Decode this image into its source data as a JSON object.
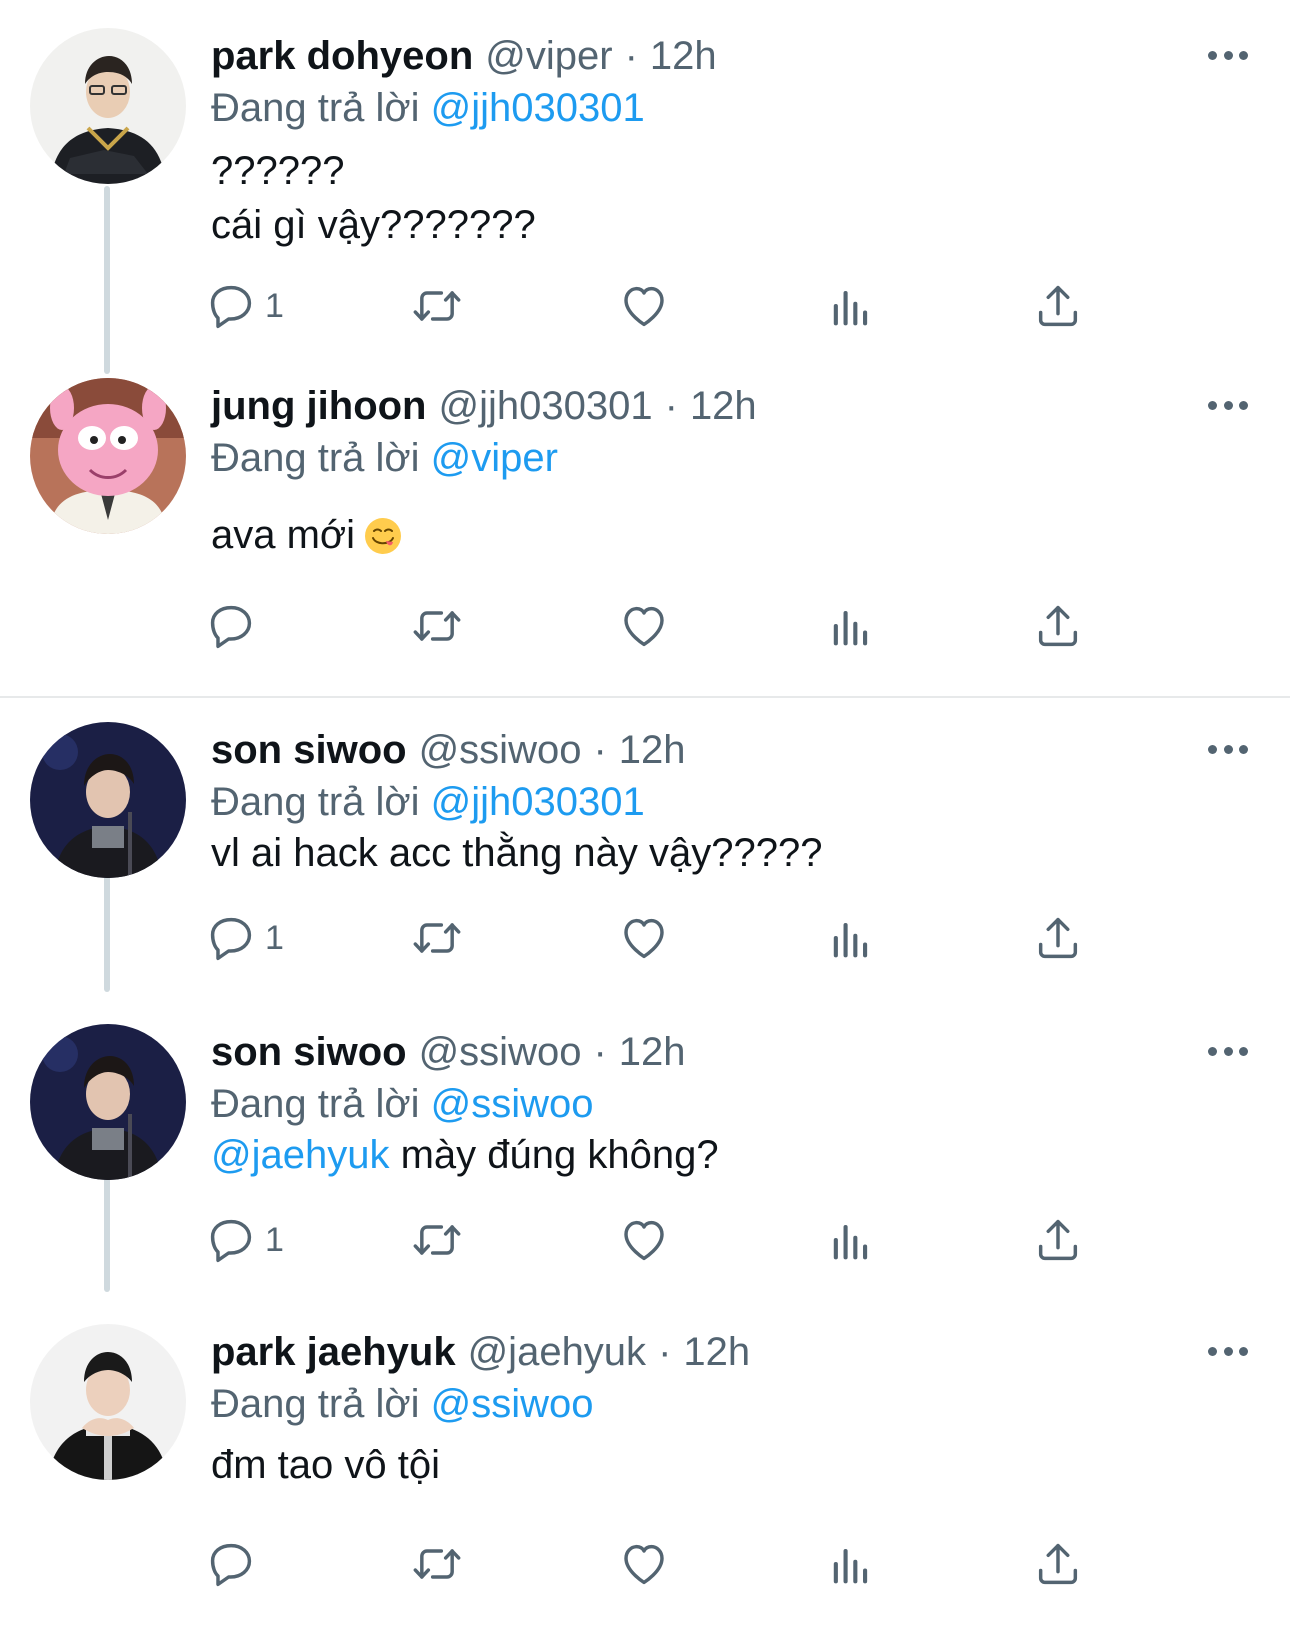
{
  "reply_prefix": "Đang trả lời",
  "tweets": [
    {
      "name": "park dohyeon",
      "handle": "@viper",
      "separator": "·",
      "time": "12h",
      "reply_to": "@jjh030301",
      "line1": "??????",
      "line2": "cái gì vậy???????",
      "reply_count": "1"
    },
    {
      "name": "jung jihoon",
      "handle": "@jjh030301",
      "separator": "·",
      "time": "12h",
      "reply_to": "@viper",
      "line1": "ava mới",
      "emoji": "smiling-face-savoring-food",
      "reply_count": ""
    },
    {
      "name": "son siwoo",
      "handle": "@ssiwoo",
      "separator": "·",
      "time": "12h",
      "reply_to": "@jjh030301",
      "line1": "vl ai hack acc thằng này vậy?????",
      "reply_count": "1"
    },
    {
      "name": "son siwoo",
      "handle": "@ssiwoo",
      "separator": "·",
      "time": "12h",
      "reply_to": "@ssiwoo",
      "line1_mention": "@jaehyuk",
      "line1": " mày đúng không?",
      "reply_count": "1"
    },
    {
      "name": "park jaehyuk",
      "handle": "@jaehyuk",
      "separator": "·",
      "time": "12h",
      "reply_to": "@ssiwoo",
      "line1": "đm tao vô tội",
      "reply_count": ""
    }
  ],
  "icons": {
    "reply": "reply-icon",
    "retweet": "retweet-icon",
    "like": "heart-icon",
    "views": "views-icon",
    "share": "share-icon",
    "more": "more-icon"
  },
  "colors": {
    "text": "#0f1419",
    "secondary": "#536471",
    "link": "#1d9bf0",
    "thread_line": "#cfd9de",
    "divider": "#e7e9ea"
  }
}
